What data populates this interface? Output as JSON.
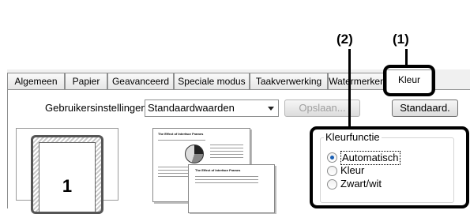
{
  "callouts": [
    "(2)",
    "(1)"
  ],
  "tabs": [
    {
      "label": "Algemeen"
    },
    {
      "label": "Papier"
    },
    {
      "label": "Geavanceerd"
    },
    {
      "label": "Speciale modus"
    },
    {
      "label": "Taakverwerking"
    },
    {
      "label": "Watermerken"
    },
    {
      "label": "Kleur",
      "active": true
    }
  ],
  "settings": {
    "label": "Gebruikersinstellingen:",
    "selected": "Standaardwaarden",
    "save_button": "Opslaan...",
    "default_button": "Standaard."
  },
  "preview": {
    "page_number": "1",
    "doc_title": "The Effect of Interface Frames"
  },
  "color_function": {
    "legend": "Kleurfunctie",
    "options": [
      {
        "label": "Automatisch",
        "checked": true
      },
      {
        "label": "Kleur",
        "checked": false
      },
      {
        "label": "Zwart/wit",
        "checked": false
      }
    ]
  }
}
